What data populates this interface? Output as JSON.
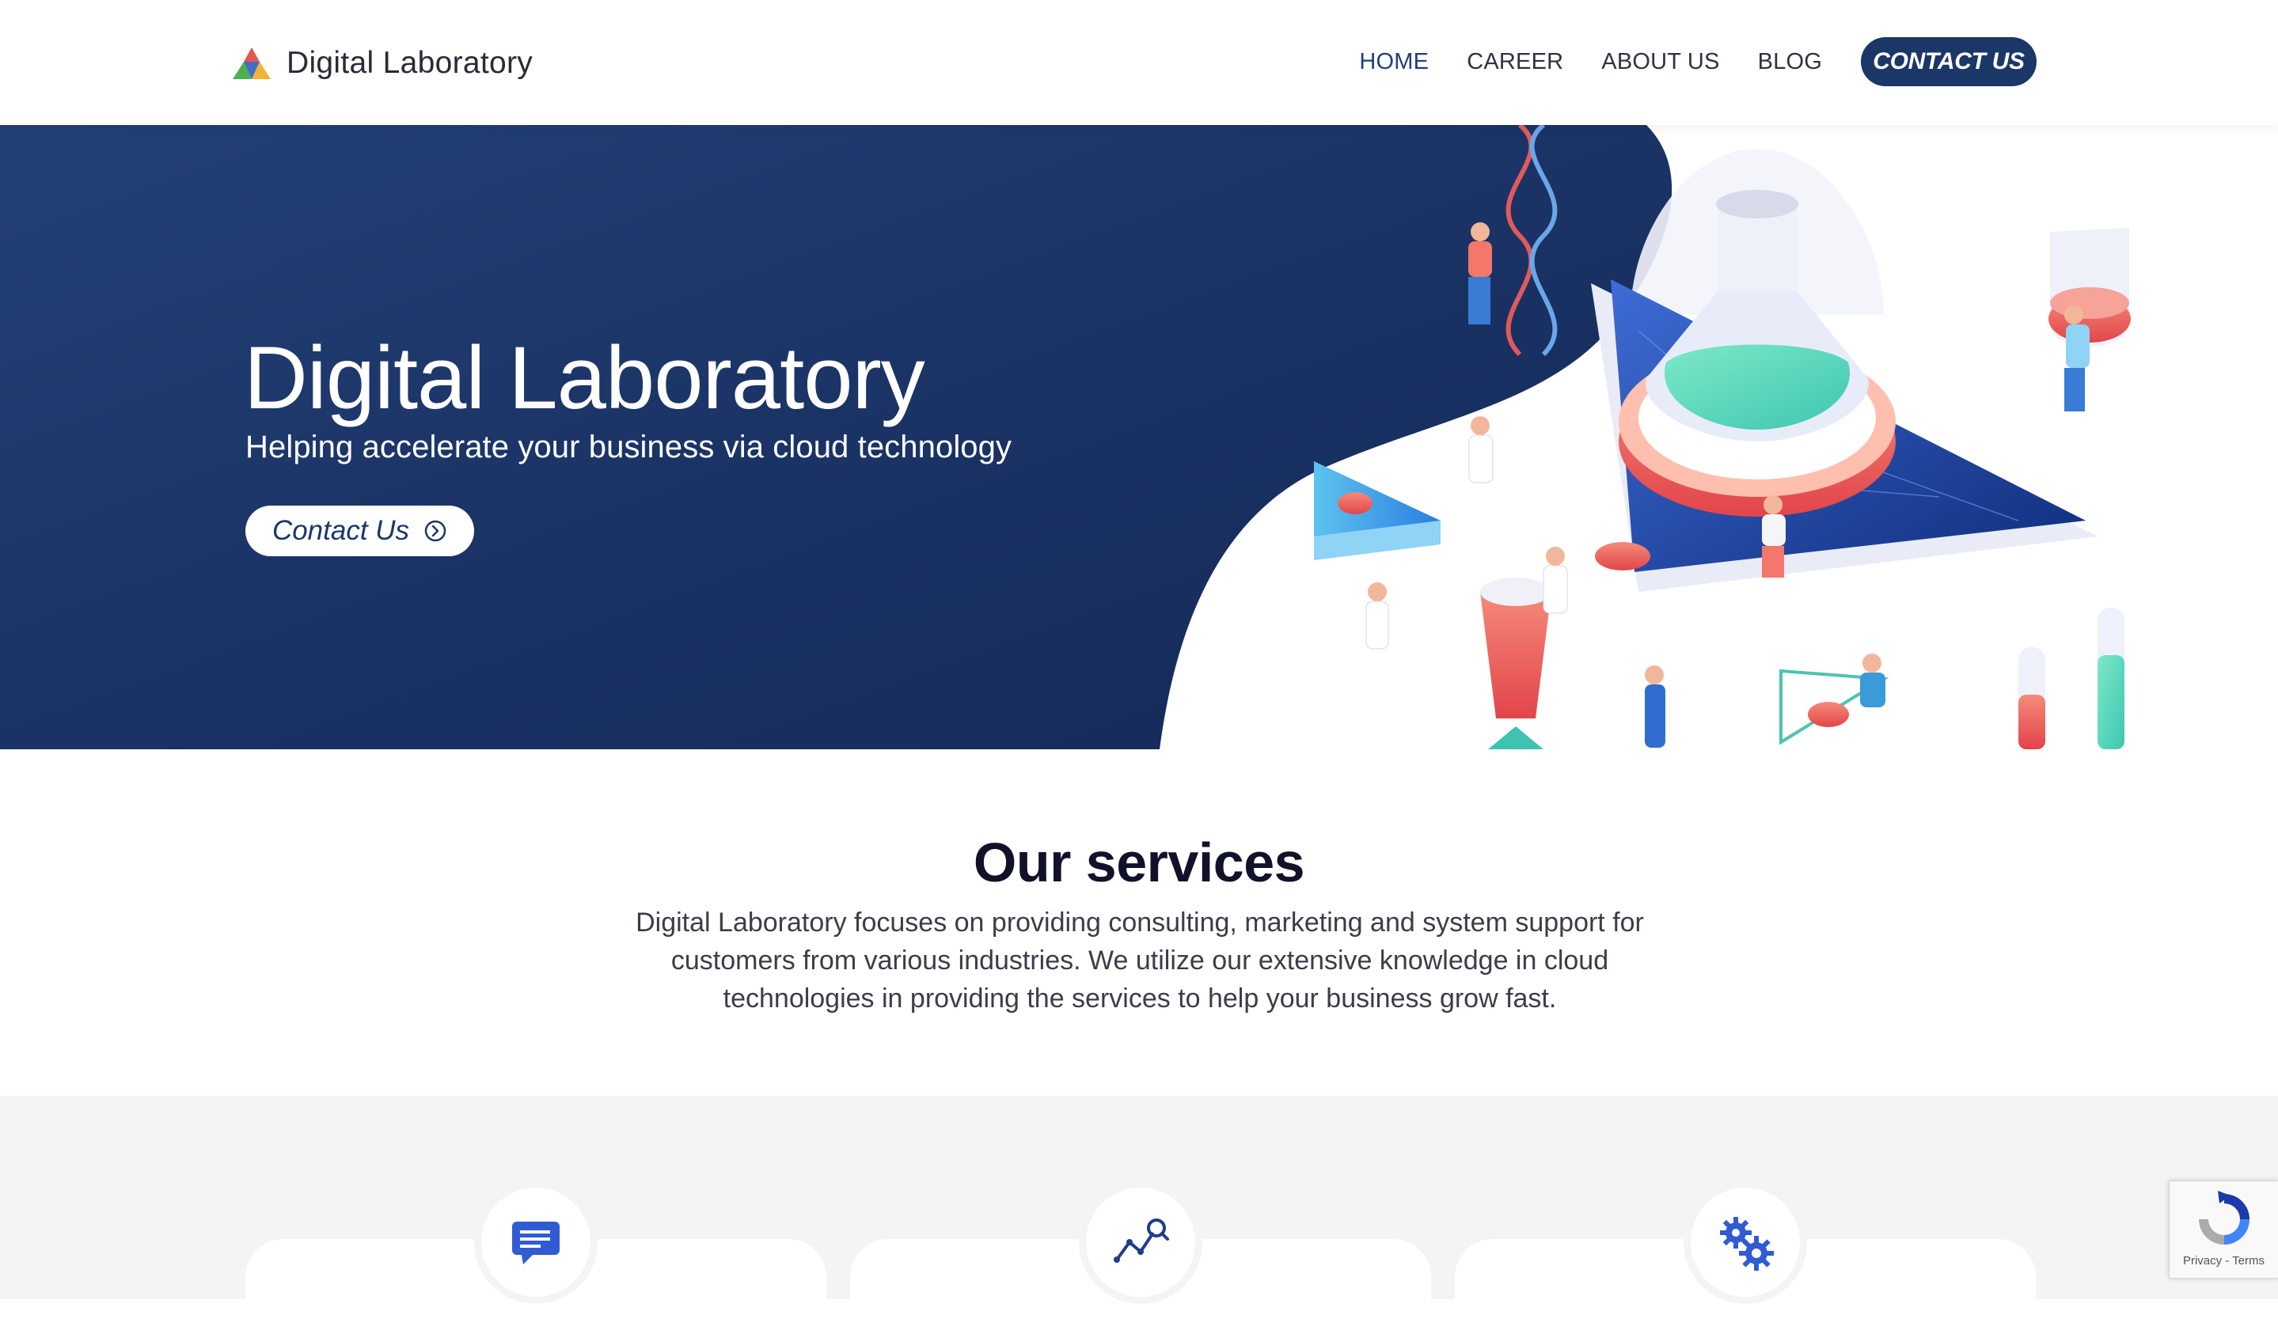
{
  "header": {
    "brand": "Digital Laboratory",
    "nav": [
      {
        "label": "HOME",
        "active": true
      },
      {
        "label": "CAREER",
        "active": false
      },
      {
        "label": "ABOUT US",
        "active": false
      },
      {
        "label": "BLOG",
        "active": false
      }
    ],
    "cta_label": "CONTACT US"
  },
  "hero": {
    "title": "Digital Laboratory",
    "subtitle": "Helping accelerate your business via cloud technology",
    "button_label": "Contact Us"
  },
  "services": {
    "title": "Our services",
    "description": "Digital Laboratory focuses on providing consulting, marketing and system support for customers from various industries. We utilize our extensive knowledge in cloud technologies in providing the services to help your business grow fast.",
    "cards": [
      {
        "icon": "chat-icon"
      },
      {
        "icon": "analytics-search-icon"
      },
      {
        "icon": "gears-icon"
      }
    ]
  },
  "recaptcha": {
    "privacy": "Privacy",
    "separator": " - ",
    "terms": "Terms"
  },
  "colors": {
    "primary_navy": "#1a3768",
    "hero_gradient_start": "#234176",
    "hero_gradient_end": "#122653",
    "band_gray": "#f4f4f5"
  }
}
